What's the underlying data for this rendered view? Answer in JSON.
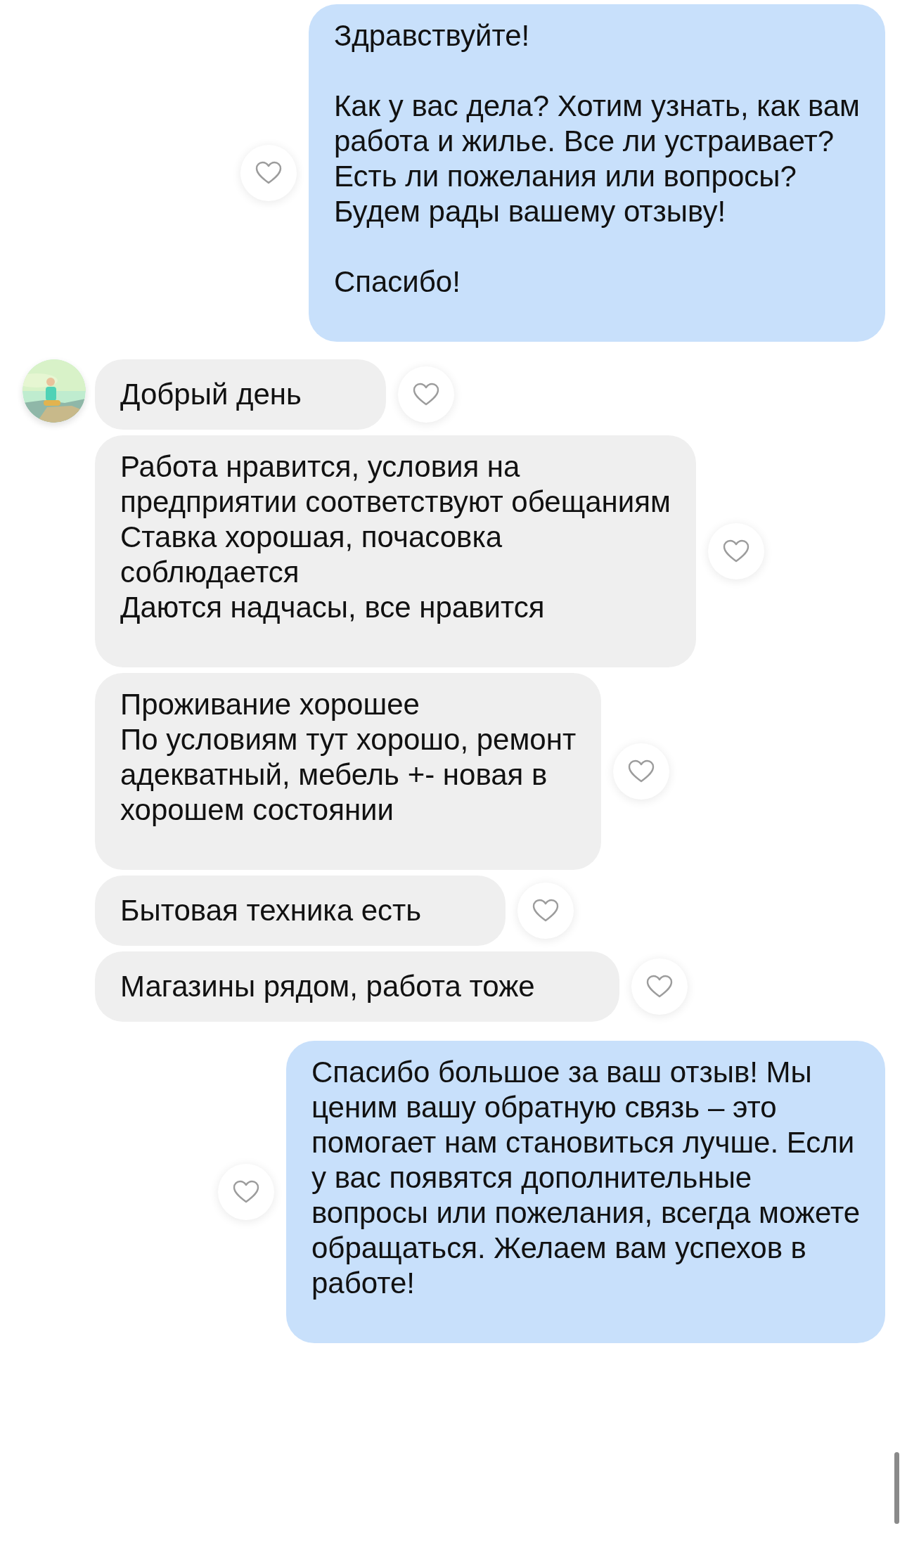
{
  "messages": [
    {
      "kind": "outgoing",
      "text": "Здравствуйте!\n\nКак у вас дела? Хотим узнать, как вам\nработа и жилье. Все ли устраивает?\nЕсть ли пожелания или вопросы?\nБудем рады вашему отзыву!\n\nСпасибо!"
    },
    {
      "kind": "incoming",
      "text": "Добрый день"
    },
    {
      "kind": "incoming",
      "text": "Работа нравится, условия на\nпредприятии соответствуют обещаниям\nСтавка хорошая, почасовка\nсоблюдается\nДаются надчасы, все нравится"
    },
    {
      "kind": "incoming",
      "text": "Проживание хорошее\nПо условиям тут хорошо, ремонт\nадекватный, мебель +- новая в\nхорошем состоянии"
    },
    {
      "kind": "incoming",
      "text": "Бытовая техника есть"
    },
    {
      "kind": "incoming",
      "text": "Магазины рядом, работа тоже"
    },
    {
      "kind": "outgoing",
      "text": "Спасибо большое за ваш отзыв! Мы\nценим вашу обратную связь – это\nпомогает нам становиться лучше. Если\nу вас появятся дополнительные\nвопросы или пожелания, всегда можете\nобращаться. Желаем вам успехов в\nработе!"
    }
  ]
}
